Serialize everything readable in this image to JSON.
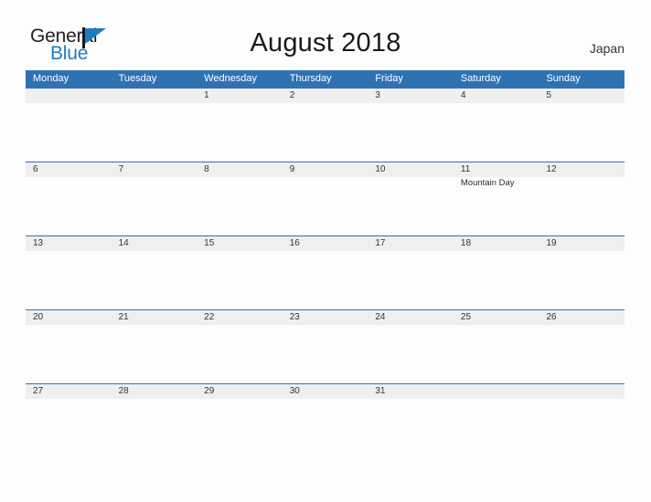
{
  "brand": {
    "name_part1": "General",
    "name_part2": "Blue"
  },
  "header": {
    "title": "August 2018",
    "country": "Japan"
  },
  "colors": {
    "header_blue": "#2f72b4",
    "row_band_gray": "#efefef",
    "brand_blue": "#1f7bc1",
    "page_background": "#fdfdfd"
  },
  "calendar": {
    "weekdays": [
      "Monday",
      "Tuesday",
      "Wednesday",
      "Thursday",
      "Friday",
      "Saturday",
      "Sunday"
    ],
    "weeks": [
      [
        {
          "date": "",
          "event": ""
        },
        {
          "date": "",
          "event": ""
        },
        {
          "date": "1",
          "event": ""
        },
        {
          "date": "2",
          "event": ""
        },
        {
          "date": "3",
          "event": ""
        },
        {
          "date": "4",
          "event": ""
        },
        {
          "date": "5",
          "event": ""
        }
      ],
      [
        {
          "date": "6",
          "event": ""
        },
        {
          "date": "7",
          "event": ""
        },
        {
          "date": "8",
          "event": ""
        },
        {
          "date": "9",
          "event": ""
        },
        {
          "date": "10",
          "event": ""
        },
        {
          "date": "11",
          "event": "Mountain Day"
        },
        {
          "date": "12",
          "event": ""
        }
      ],
      [
        {
          "date": "13",
          "event": ""
        },
        {
          "date": "14",
          "event": ""
        },
        {
          "date": "15",
          "event": ""
        },
        {
          "date": "16",
          "event": ""
        },
        {
          "date": "17",
          "event": ""
        },
        {
          "date": "18",
          "event": ""
        },
        {
          "date": "19",
          "event": ""
        }
      ],
      [
        {
          "date": "20",
          "event": ""
        },
        {
          "date": "21",
          "event": ""
        },
        {
          "date": "22",
          "event": ""
        },
        {
          "date": "23",
          "event": ""
        },
        {
          "date": "24",
          "event": ""
        },
        {
          "date": "25",
          "event": ""
        },
        {
          "date": "26",
          "event": ""
        }
      ],
      [
        {
          "date": "27",
          "event": ""
        },
        {
          "date": "28",
          "event": ""
        },
        {
          "date": "29",
          "event": ""
        },
        {
          "date": "30",
          "event": ""
        },
        {
          "date": "31",
          "event": ""
        },
        {
          "date": "",
          "event": ""
        },
        {
          "date": "",
          "event": ""
        }
      ]
    ]
  }
}
